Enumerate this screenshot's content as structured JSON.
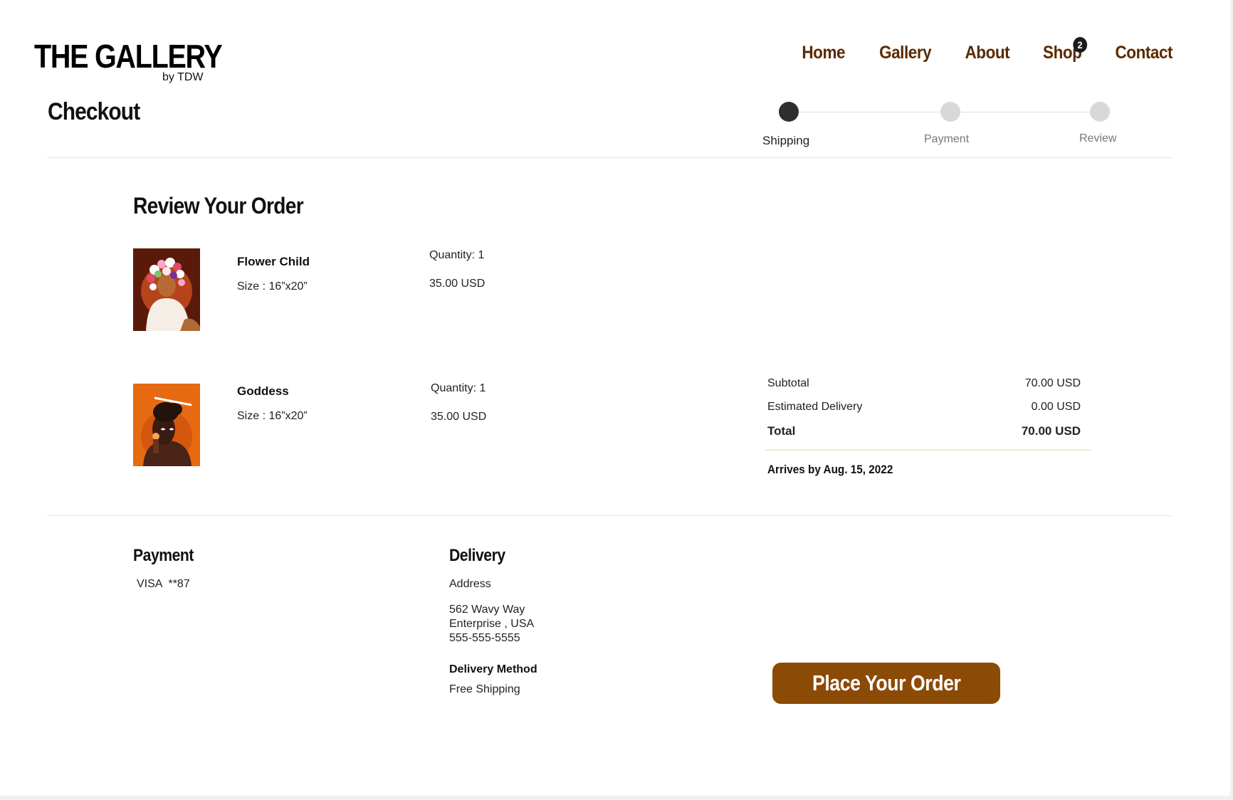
{
  "header": {
    "logo_title": "THE GALLERY",
    "logo_sub": "by TDW",
    "nav": [
      {
        "label": "Home"
      },
      {
        "label": "Gallery"
      },
      {
        "label": "About"
      },
      {
        "label": "Shop",
        "badge": "2"
      },
      {
        "label": "Contact"
      }
    ]
  },
  "checkout": {
    "title": "Checkout",
    "steps": [
      {
        "label": "Shipping",
        "active": true
      },
      {
        "label": "Payment",
        "active": false
      },
      {
        "label": "Review",
        "active": false
      }
    ]
  },
  "review": {
    "title": "Review Your Order",
    "items": [
      {
        "name": "Flower Child",
        "size": "Size : 16”x20”",
        "quantity": "Quantity: 1",
        "price": "35.00 USD",
        "thumb_color": "#5a1a0a"
      },
      {
        "name": "Goddess",
        "size": "Size : 16”x20”",
        "quantity": "Quantity: 1",
        "price": "35.00 USD",
        "thumb_color": "#e66a12"
      }
    ]
  },
  "summary": {
    "subtotal_label": "Subtotal",
    "subtotal_value": "70.00 USD",
    "delivery_label": "Estimated Delivery",
    "delivery_value": "0.00 USD",
    "total_label": "Total",
    "total_value": "70.00 USD",
    "arrives": "Arrives by Aug. 15, 2022"
  },
  "payment": {
    "title": "Payment",
    "card": "VISA  **87"
  },
  "delivery": {
    "title": "Delivery",
    "address_label": "Address",
    "address_line1": "562 Wavy Way",
    "address_line2": "Enterprise , USA",
    "phone": "555-555-5555",
    "method_label": "Delivery Method",
    "method_value": "Free Shipping"
  },
  "actions": {
    "place_order": "Place Your Order"
  },
  "colors": {
    "nav": "#5a2a00",
    "button": "#8b4a06",
    "step_active": "#2e2e2e",
    "step_inactive": "#d8d8d8"
  }
}
